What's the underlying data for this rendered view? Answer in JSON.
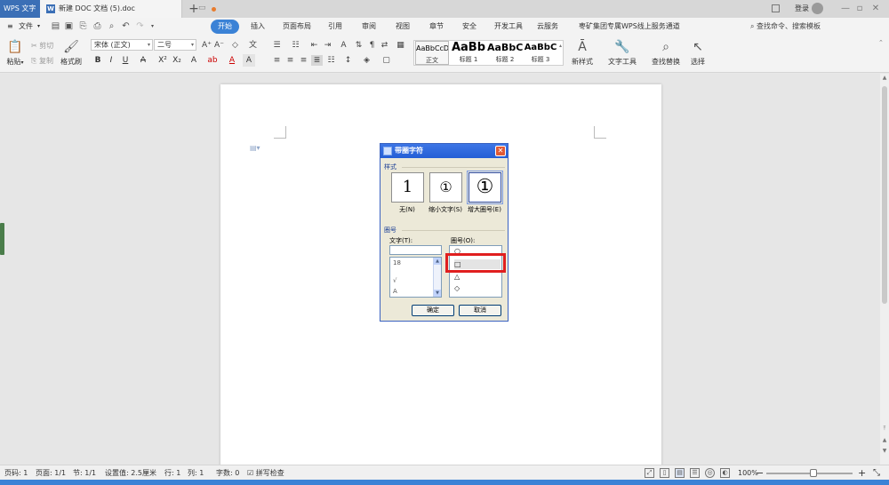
{
  "tabs": {
    "app_label": "WPS 文字",
    "doc_title": "新建 DOC 文档 (5).doc",
    "login_label": "登录"
  },
  "menu": {
    "file_label": "文件",
    "ribbon_tabs": [
      "开始",
      "插入",
      "页面布局",
      "引用",
      "审阅",
      "视图",
      "章节",
      "安全",
      "开发工具",
      "云服务",
      "枣矿集团专属WPS线上服务通道"
    ],
    "active_tab": "开始",
    "search_placeholder": "查找命令、搜索模板"
  },
  "ribbon": {
    "paste_label": "粘贴",
    "cut_label": "剪切",
    "copy_label": "复制",
    "format_painter_label": "格式刷",
    "font_name": "宋体 (正文)",
    "font_size": "二号",
    "styles": [
      {
        "preview": "AaBbCcDd",
        "caption": "正文"
      },
      {
        "preview": "AaBb",
        "caption": "标题 1"
      },
      {
        "preview": "AaBbC",
        "caption": "标题 2"
      },
      {
        "preview": "AaBbC",
        "caption": "标题 3"
      }
    ],
    "new_style_label": "新样式",
    "text_tools_label": "文字工具",
    "find_replace_label": "查找替换",
    "select_label": "选择"
  },
  "dialog": {
    "title": "带圈字符",
    "style_group": "样式",
    "style_options": [
      {
        "glyph": "1",
        "label": "无(N)"
      },
      {
        "glyph": "①",
        "label": "缩小文字(S)"
      },
      {
        "glyph": "①",
        "label": "增大圈号(E)"
      }
    ],
    "selected_style_index": 2,
    "circle_group": "圈号",
    "text_label": "文字(T):",
    "text_value": "",
    "text_list": [
      "18",
      "√",
      "A"
    ],
    "enclosure_label": "圈号(O):",
    "enclosure_list": [
      "○",
      "□",
      "△",
      "◇"
    ],
    "selected_enclosure_index": 1,
    "ok_label": "确定",
    "cancel_label": "取消"
  },
  "status": {
    "page": "页码: 1",
    "pages": "页面: 1/1",
    "section": "节: 1/1",
    "setting": "设置值: 2.5厘米",
    "row": "行: 1",
    "col": "列: 1",
    "word_count": "字数: 0",
    "spell_check": "拼写检查",
    "zoom": "100%"
  },
  "colors": {
    "accent": "#3b82d6",
    "app_tab": "#3b6fb6",
    "highlight": "#e01f1f",
    "dialog_bg": "#ece9d8"
  }
}
